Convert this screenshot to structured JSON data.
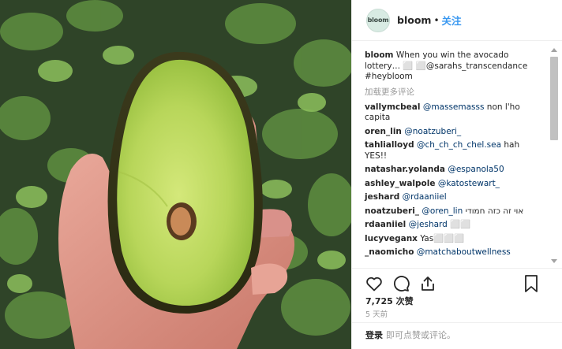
{
  "header": {
    "avatar_text": "bloom",
    "username": "bloom",
    "separator": "•",
    "follow_label": "关注"
  },
  "caption": {
    "user": "bloom",
    "text": "When you win the avocado lottery… ⬜ ⬜@sarahs_transcendance #heybloom"
  },
  "load_more": "加载更多评论",
  "comments": [
    {
      "user": "vallymcbeal",
      "mention": "@massemasss",
      "text": " non l'ho capita"
    },
    {
      "user": "oren_lin",
      "mention": "@noatzuberi_",
      "text": ""
    },
    {
      "user": "tahlialloyd",
      "mention": "@ch_ch_ch_chel.sea",
      "text": " hah YES!!"
    },
    {
      "user": "natashar.yolanda",
      "mention": "@espanola50",
      "text": ""
    },
    {
      "user": "ashley_walpole",
      "mention": "@katostewart_",
      "text": ""
    },
    {
      "user": "jeshard",
      "mention": "@rdaaniiel",
      "text": ""
    },
    {
      "user": "noatzuberi_",
      "mention": "@oren_lin",
      "text": " אוי זה כזה חמודי"
    },
    {
      "user": "rdaaniiel",
      "mention": "@jeshard",
      "text": " ⬜⬜"
    },
    {
      "user": "lucyveganx",
      "mention": "",
      "text": " Yas⬜⬜⬜"
    },
    {
      "user": "_naomicho",
      "mention": "@matchaboutwellness",
      "text": ""
    }
  ],
  "actions": {
    "icons": [
      "heart-icon",
      "comment-icon",
      "share-icon",
      "bookmark-icon"
    ],
    "likes": "7,725 次赞",
    "time": "5 天前"
  },
  "login": {
    "link": "登录",
    "text": "即可点赞或评论。"
  },
  "colors": {
    "link": "#003569",
    "follow": "#3897f0",
    "muted": "#999999",
    "avocado_flesh": "#b9d85a",
    "avocado_skin": "#3a3d1e"
  }
}
